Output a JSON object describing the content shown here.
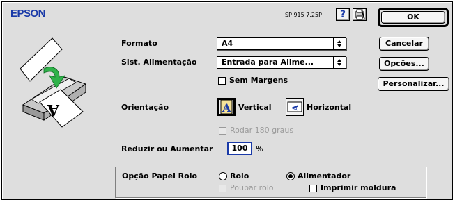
{
  "brand": {
    "name": "EPSON",
    "version": "SP 915 7.25P"
  },
  "toolbar": {
    "help_label": "?",
    "help_icon": "question-mark-icon",
    "util_icon": "printer-utility-icon"
  },
  "buttons": {
    "ok": "OK",
    "cancel": "Cancelar",
    "options": "Opções...",
    "customize": "Personalizar..."
  },
  "format": {
    "label": "Formato",
    "value": "A4"
  },
  "paper_source": {
    "label": "Sist. Alimentação",
    "value": "Entrada para Alime..."
  },
  "borderless": {
    "label": "Sem Margens",
    "checked": false
  },
  "orientation": {
    "label": "Orientação",
    "vertical_label": "Vertical",
    "horizontal_label": "Horizontal",
    "selected": "Vertical"
  },
  "rotate180": {
    "label": "Rodar 180 graus",
    "enabled": false
  },
  "scale": {
    "label": "Reduzir ou Aumentar",
    "value": "100",
    "unit": "%"
  },
  "roll_option": {
    "label": "Opção Papel Rolo",
    "roll_label": "Rolo",
    "feeder_label": "Alimentador",
    "selected": "Alimentador",
    "save_roll_label": "Poupar rolo",
    "print_frame_label": "Imprimir moldura"
  },
  "colors": {
    "brand_blue": "#1a3aa8",
    "dialog_bg": "#dedede",
    "arrow_green": "#2fb24a"
  }
}
